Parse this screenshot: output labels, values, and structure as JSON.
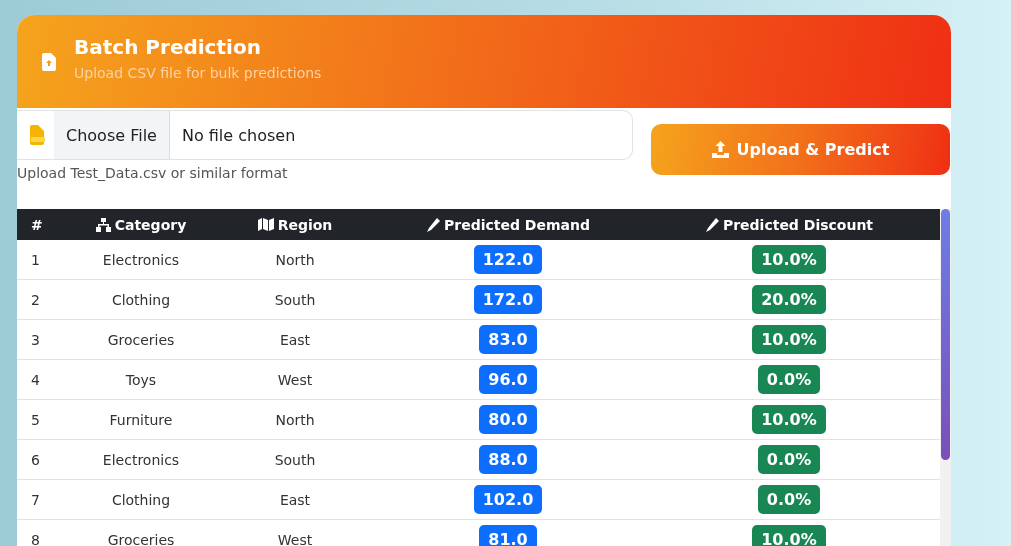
{
  "header": {
    "title": "Batch Prediction",
    "subtitle": "Upload CSV file for bulk predictions"
  },
  "upload": {
    "choose_button": "Choose File",
    "file_status": "No file chosen",
    "hint": "Upload Test_Data.csv or similar format",
    "submit_button": "Upload & Predict"
  },
  "table": {
    "columns": [
      {
        "label": "#"
      },
      {
        "label": "Category"
      },
      {
        "label": "Region"
      },
      {
        "label": "Predicted Demand"
      },
      {
        "label": "Predicted Discount"
      }
    ],
    "rows": [
      {
        "index": "1",
        "category": "Electronics",
        "region": "North",
        "demand": "122.0",
        "discount": "10.0%"
      },
      {
        "index": "2",
        "category": "Clothing",
        "region": "South",
        "demand": "172.0",
        "discount": "20.0%"
      },
      {
        "index": "3",
        "category": "Groceries",
        "region": "East",
        "demand": "83.0",
        "discount": "10.0%"
      },
      {
        "index": "4",
        "category": "Toys",
        "region": "West",
        "demand": "96.0",
        "discount": "0.0%"
      },
      {
        "index": "5",
        "category": "Furniture",
        "region": "North",
        "demand": "80.0",
        "discount": "10.0%"
      },
      {
        "index": "6",
        "category": "Electronics",
        "region": "South",
        "demand": "88.0",
        "discount": "0.0%"
      },
      {
        "index": "7",
        "category": "Clothing",
        "region": "East",
        "demand": "102.0",
        "discount": "0.0%"
      },
      {
        "index": "8",
        "category": "Groceries",
        "region": "West",
        "demand": "81.0",
        "discount": "10.0%"
      }
    ]
  }
}
